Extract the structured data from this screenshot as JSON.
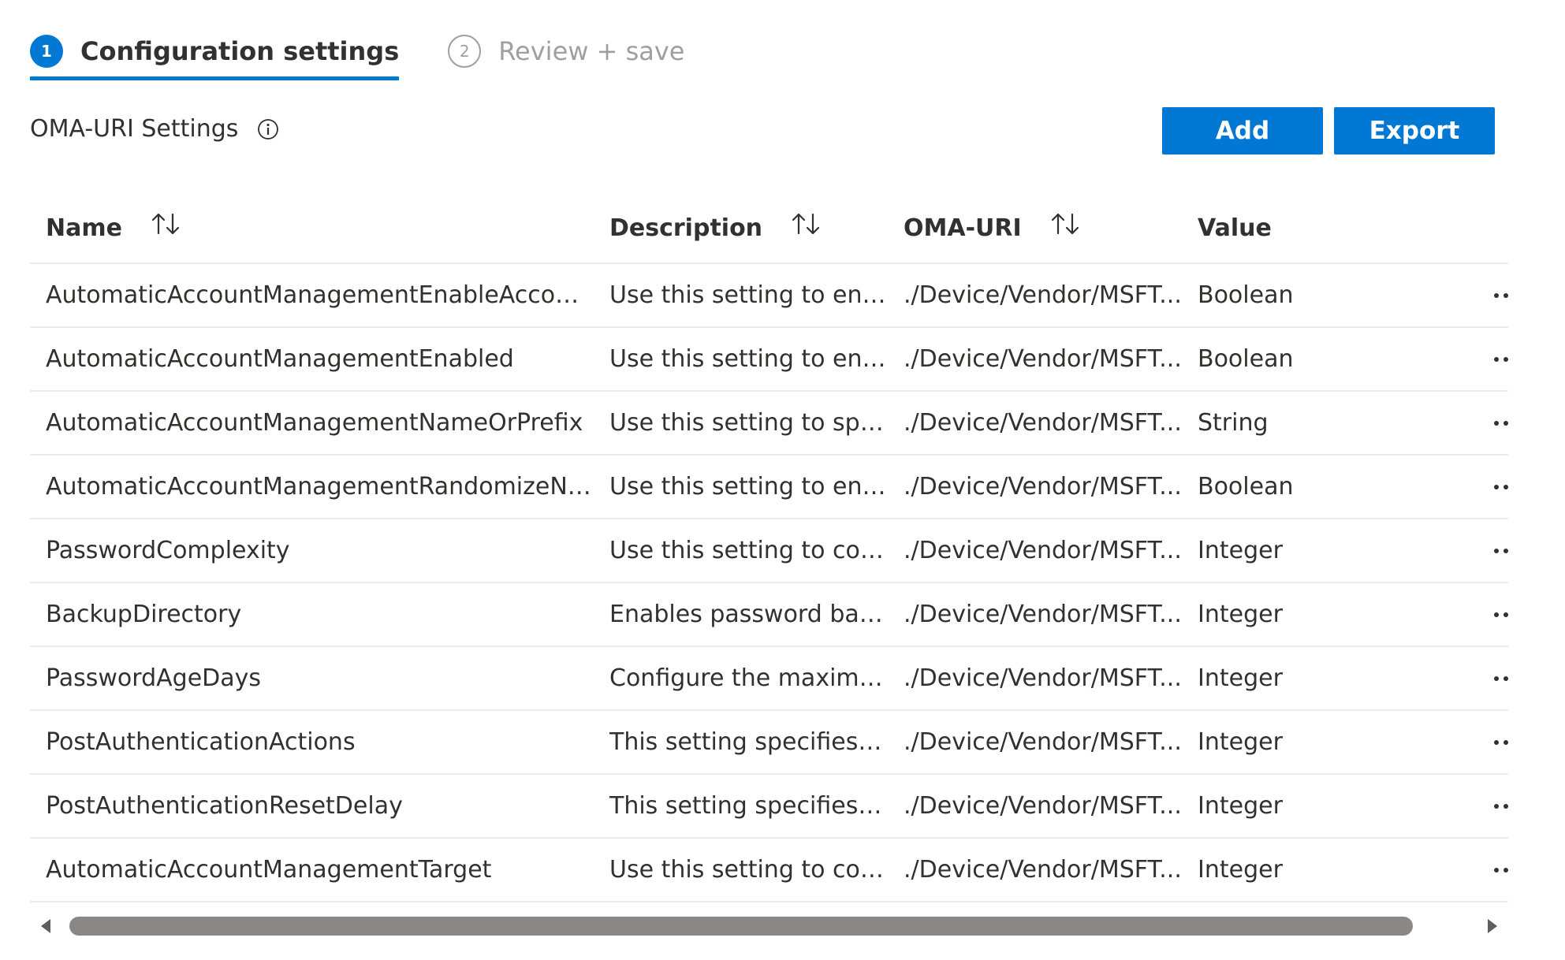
{
  "wizard": {
    "steps": [
      {
        "number": "1",
        "label": "Configuration settings",
        "state": "active"
      },
      {
        "number": "2",
        "label": "Review + save",
        "state": "inactive"
      }
    ]
  },
  "section": {
    "title": "OMA-URI Settings",
    "info_icon": "info-icon"
  },
  "toolbar": {
    "add_label": "Add",
    "export_label": "Export"
  },
  "table": {
    "columns": [
      {
        "label": "Name",
        "sortable": true
      },
      {
        "label": "Description",
        "sortable": true
      },
      {
        "label": "OMA-URI",
        "sortable": true
      },
      {
        "label": "Value",
        "sortable": false
      }
    ],
    "rows": [
      {
        "name": "AutomaticAccountManagementEnableAccount",
        "description": "Use this setting to ena...",
        "oma_uri": "./Device/Vendor/MSFT...",
        "value": "Boolean"
      },
      {
        "name": "AutomaticAccountManagementEnabled",
        "description": "Use this setting to ena...",
        "oma_uri": "./Device/Vendor/MSFT...",
        "value": "Boolean"
      },
      {
        "name": "AutomaticAccountManagementNameOrPrefix",
        "description": "Use this setting to spe...",
        "oma_uri": "./Device/Vendor/MSFT...",
        "value": "String"
      },
      {
        "name": "AutomaticAccountManagementRandomizeNa...",
        "description": "Use this setting to ena...",
        "oma_uri": "./Device/Vendor/MSFT...",
        "value": "Boolean"
      },
      {
        "name": "PasswordComplexity",
        "description": "Use this setting to con...",
        "oma_uri": "./Device/Vendor/MSFT...",
        "value": "Integer"
      },
      {
        "name": "BackupDirectory",
        "description": "Enables password bac...",
        "oma_uri": "./Device/Vendor/MSFT...",
        "value": "Integer"
      },
      {
        "name": "PasswordAgeDays",
        "description": "Configure the maximu...",
        "oma_uri": "./Device/Vendor/MSFT...",
        "value": "Integer"
      },
      {
        "name": "PostAuthenticationActions",
        "description": "This setting specifies t...",
        "oma_uri": "./Device/Vendor/MSFT...",
        "value": "Integer"
      },
      {
        "name": "PostAuthenticationResetDelay",
        "description": "This setting specifies t...",
        "oma_uri": "./Device/Vendor/MSFT...",
        "value": "Integer"
      },
      {
        "name": "AutomaticAccountManagementTarget",
        "description": "Use this setting to con...",
        "oma_uri": "./Device/Vendor/MSFT...",
        "value": "Integer"
      }
    ],
    "row_action_icon": "more-horizontal-icon",
    "sort_icon": "sort-arrows-icon"
  },
  "scrollbar": {
    "left_icon": "chevron-left-icon",
    "right_icon": "chevron-right-icon"
  },
  "colors": {
    "accent": "#0078d4",
    "text": "#323130",
    "muted": "#a19f9d",
    "divider": "#edebe9",
    "scroll_thumb": "#8a8886"
  }
}
